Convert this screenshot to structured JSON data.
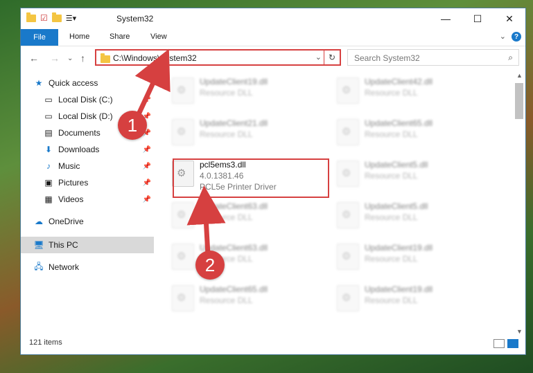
{
  "window": {
    "title": "System32"
  },
  "ribbon": {
    "file": "File",
    "tabs": [
      "Home",
      "Share",
      "View"
    ],
    "help": "?"
  },
  "address": {
    "path": "C:\\Windows\\System32"
  },
  "search": {
    "placeholder": "Search System32"
  },
  "sidebar": {
    "items": [
      {
        "label": "Quick access",
        "icon": "star-icon"
      },
      {
        "label": "Local Disk (C:)",
        "icon": "drive-icon"
      },
      {
        "label": "Local Disk (D:)",
        "icon": "drive-icon"
      },
      {
        "label": "Documents",
        "icon": "documents-icon"
      },
      {
        "label": "Downloads",
        "icon": "download-icon"
      },
      {
        "label": "Music",
        "icon": "music-icon"
      },
      {
        "label": "Pictures",
        "icon": "pictures-icon"
      },
      {
        "label": "Videos",
        "icon": "videos-icon"
      },
      {
        "label": "OneDrive",
        "icon": "cloud-icon"
      },
      {
        "label": "This PC",
        "icon": "computer-icon"
      },
      {
        "label": "Network",
        "icon": "network-icon"
      }
    ]
  },
  "files": [
    {
      "name": "UpdateClient19.dll",
      "desc": "Resource DLL"
    },
    {
      "name": "UpdateClient42.dll",
      "desc": "Resource DLL"
    },
    {
      "name": "UpdateClient21.dll",
      "desc": "Resource DLL"
    },
    {
      "name": "UpdateClient65.dll",
      "desc": "Resource DLL"
    },
    {
      "name": "pcl5ems3.dll",
      "version": "4.0.1381.46",
      "desc": "PCL5e Printer Driver"
    },
    {
      "name": "UpdateClient5.dll",
      "desc": "Resource DLL"
    },
    {
      "name": "UpdateClient63.dll",
      "desc": "Resource DLL"
    },
    {
      "name": "UpdateClient5.dll",
      "desc": "Resource DLL"
    },
    {
      "name": "UpdateClient63.dll",
      "desc": "Resource DLL"
    },
    {
      "name": "UpdateClient19.dll",
      "desc": "Resource DLL"
    },
    {
      "name": "UpdateClient65.dll",
      "desc": "Resource DLL"
    },
    {
      "name": "UpdateClient19.dll",
      "desc": "Resource DLL"
    }
  ],
  "status": {
    "count": "121 items"
  },
  "annotations": {
    "step1": "1",
    "step2": "2",
    "color": "#d64040"
  }
}
